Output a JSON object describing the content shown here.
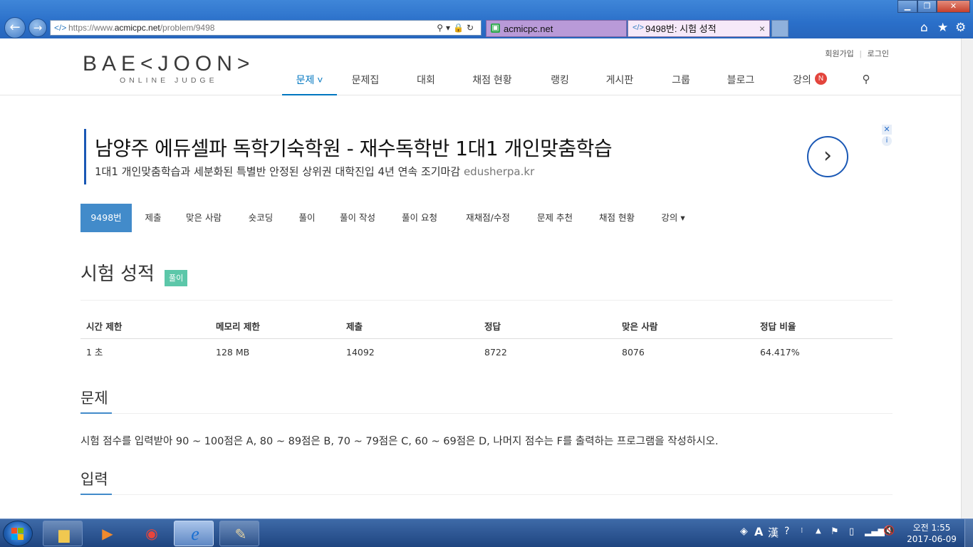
{
  "browser": {
    "url_prefix": "https://www.",
    "url_domain": "acmicpc.net",
    "url_path": "/problem/9498",
    "tabs": [
      {
        "label": "acmicpc.net"
      },
      {
        "label": "9498번: 시험 성적"
      }
    ],
    "tab_close_glyph": "×",
    "back_glyph": "←",
    "forward_glyph": "→",
    "address_tools": "⚲▾🔒↻"
  },
  "site": {
    "logo_main": "BAE<JOON>",
    "logo_sub": "ONLINE JUDGE",
    "top_links": [
      "회원가입",
      "로그인"
    ],
    "nav": [
      {
        "label": "문제 ˅",
        "active": true
      },
      {
        "label": "문제집"
      },
      {
        "label": "대회"
      },
      {
        "label": "채점 현황"
      },
      {
        "label": "랭킹"
      },
      {
        "label": "게시판"
      },
      {
        "label": "그룹"
      },
      {
        "label": "블로그"
      },
      {
        "label": "강의"
      }
    ],
    "nav_badge": "N"
  },
  "ad": {
    "title": "남양주 에듀셀파 독학기숙학원 - 재수독학반 1대1 개인맞춤학습",
    "description": "1대1 개인맞춤학습과 세분화된 특별반 안정된 상위권 대학진입 4년 연속 조기마감",
    "domain": "edusherpa.kr",
    "arrow_glyph": "›",
    "close_glyph": "✕",
    "info_glyph": "i"
  },
  "problem_menu": [
    {
      "label": "9498번",
      "active": true
    },
    {
      "label": "제출"
    },
    {
      "label": "맞은 사람"
    },
    {
      "label": "숏코딩"
    },
    {
      "label": "풀이"
    },
    {
      "label": "풀이 작성"
    },
    {
      "label": "풀이 요청"
    },
    {
      "label": "재채점/수정"
    },
    {
      "label": "문제 추천"
    },
    {
      "label": "채점 현황"
    },
    {
      "label": "강의 ▾"
    }
  ],
  "problem": {
    "title": "시험 성적",
    "tag": "풀이",
    "info_headers": [
      "시간 제한",
      "메모리 제한",
      "제출",
      "정답",
      "맞은 사람",
      "정답 비율"
    ],
    "info_values": [
      "1 초",
      "128 MB",
      "14092",
      "8722",
      "8076",
      "64.417%"
    ],
    "section_problem": "문제",
    "description": "시험 점수를 입력받아 90 ~ 100점은 A, 80 ~ 89점은 B, 70 ~ 79점은 C, 60 ~ 69점은 D, 나머지 점수는 F를 출력하는 프로그램을 작성하시오.",
    "section_input": "입력"
  },
  "taskbar": {
    "clock_time": "오전 1:55",
    "clock_date": "2017-06-09",
    "ime_a": "A",
    "ime_han": "漢"
  },
  "colors": {
    "accent": "#428bca",
    "nav_active": "#0076c0",
    "tag": "#5cc7a9",
    "badge": "#e3453d"
  }
}
